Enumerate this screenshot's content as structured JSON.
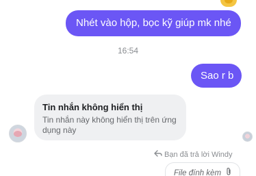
{
  "messages": {
    "outgoing_1": "Nhét vào hộp, bọc kỹ giúp mk nhé",
    "timestamp": "16:54",
    "outgoing_2": "Sao r b",
    "incoming_unavailable": {
      "title": "Tin nhắn không hiển thị",
      "body_line1": "Tin nhắn này không hiển thị trên ứng",
      "body_line2": "dụng này"
    },
    "reply_note": "Bạn đã trả lời Windy",
    "attachment_label": "File đính kèm"
  },
  "colors": {
    "outgoing_bubble": "#6b56f5",
    "incoming_bubble": "#eff0f2",
    "meta_text": "#8a8d91"
  },
  "icons": {
    "reply": "reply-arrow-icon",
    "attachment": "paperclip-icon",
    "reaction": "reaction-icon"
  }
}
